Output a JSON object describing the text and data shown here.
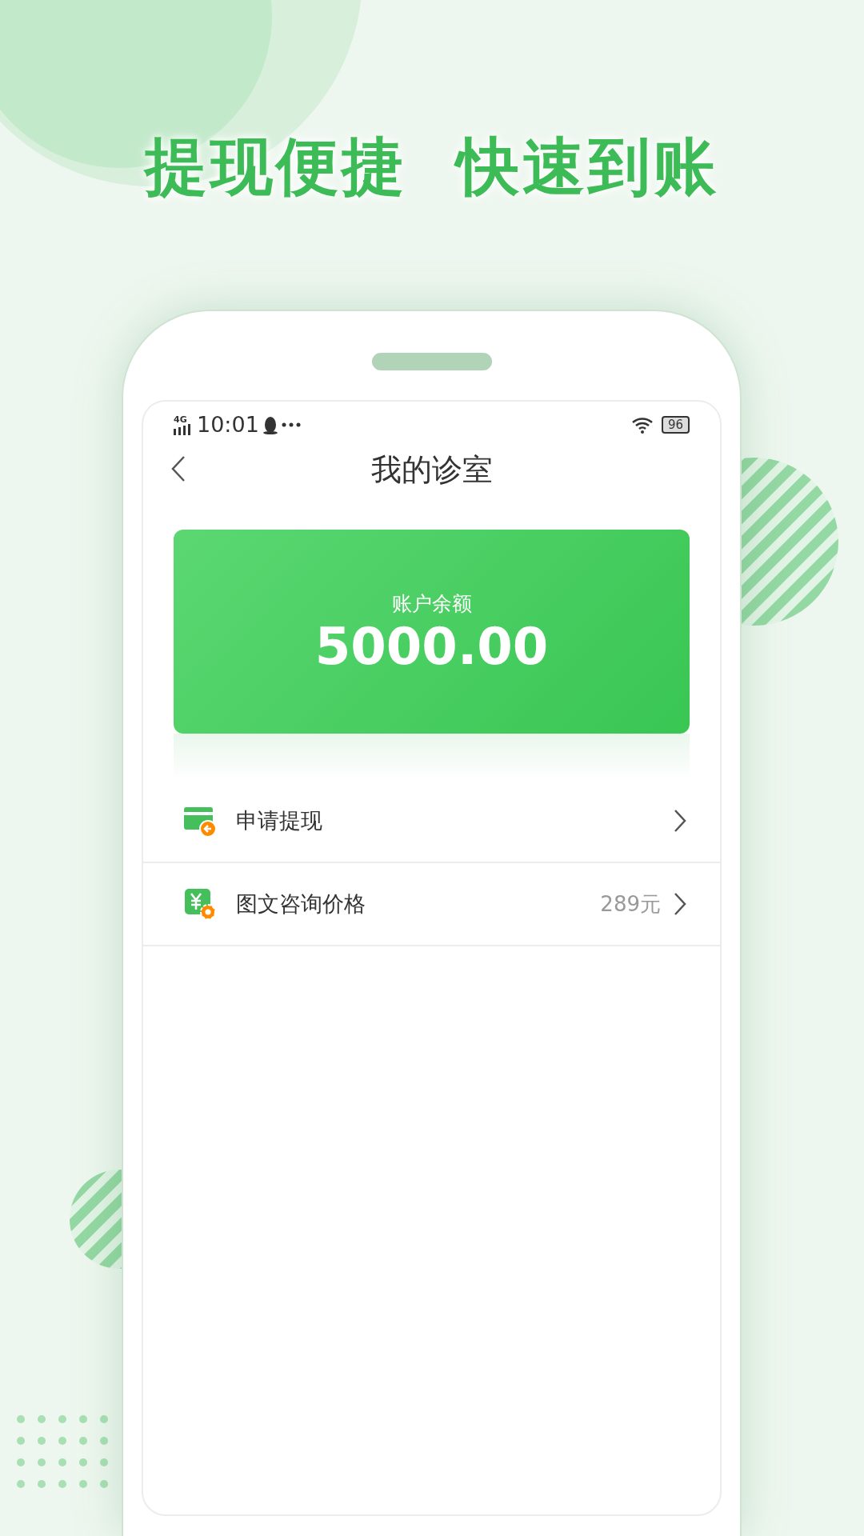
{
  "headline": "提现便捷  快速到账",
  "status_bar": {
    "network": "4G",
    "time": "10:01",
    "battery": "96"
  },
  "nav": {
    "title": "我的诊室"
  },
  "balance": {
    "label": "账户余额",
    "amount": "5000.00"
  },
  "menu": [
    {
      "kind": "withdraw",
      "label": "申请提现"
    },
    {
      "kind": "price",
      "label": "图文咨询价格",
      "value": "289元"
    }
  ]
}
